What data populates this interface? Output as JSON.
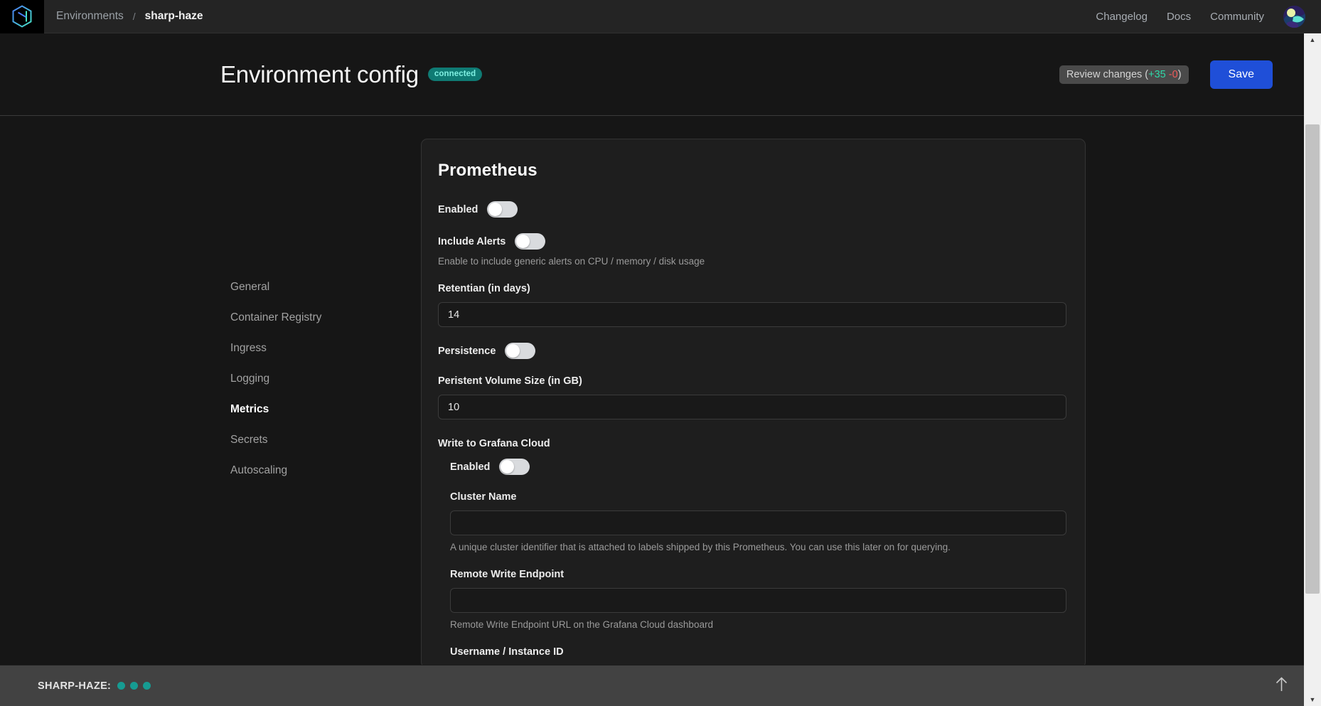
{
  "topnav": {
    "logo_icon": "hexagon-logo-icon",
    "breadcrumb": {
      "root_label": "Environments",
      "separator": "/",
      "current_label": "sharp-haze"
    },
    "links": [
      {
        "label": "Changelog",
        "name": "changelog"
      },
      {
        "label": "Docs",
        "name": "docs"
      },
      {
        "label": "Community",
        "name": "community"
      }
    ],
    "avatar_name": "user-avatar"
  },
  "header": {
    "title": "Environment config",
    "status_badge": "connected",
    "review_changes": {
      "prefix": "Review changes (",
      "additions": "+35",
      "spacer": " ",
      "deletions": "-0",
      "suffix": ")"
    },
    "save_label": "Save"
  },
  "sidebar": {
    "items": [
      {
        "label": "General",
        "name": "general",
        "active": false
      },
      {
        "label": "Container Registry",
        "name": "container-registry",
        "active": false
      },
      {
        "label": "Ingress",
        "name": "ingress",
        "active": false
      },
      {
        "label": "Logging",
        "name": "logging",
        "active": false
      },
      {
        "label": "Metrics",
        "name": "metrics",
        "active": true
      },
      {
        "label": "Secrets",
        "name": "secrets",
        "active": false
      },
      {
        "label": "Autoscaling",
        "name": "autoscaling",
        "active": false
      }
    ]
  },
  "panel": {
    "title": "Prometheus",
    "enabled": {
      "label": "Enabled",
      "state": "off"
    },
    "include_alerts": {
      "label": "Include Alerts",
      "state": "off",
      "help": "Enable to include generic alerts on CPU / memory / disk usage"
    },
    "retention": {
      "label": "Retentian (in days)",
      "value": "14",
      "placeholder": ""
    },
    "persistence": {
      "label": "Persistence",
      "state": "off"
    },
    "volume_size": {
      "label": "Peristent Volume Size (in GB)",
      "value": "10",
      "placeholder": ""
    },
    "grafana": {
      "title": "Write to Grafana Cloud",
      "enabled": {
        "label": "Enabled",
        "state": "off"
      },
      "cluster_name": {
        "label": "Cluster Name",
        "value": "",
        "placeholder": "",
        "help": "A unique cluster identifier that is attached to labels shipped by this Prometheus. You can use this later on for querying."
      },
      "remote_write_endpoint": {
        "label": "Remote Write Endpoint",
        "value": "",
        "placeholder": "",
        "help": "Remote Write Endpoint URL on the Grafana Cloud dashboard"
      },
      "username": {
        "label": "Username / Instance ID",
        "value": "",
        "placeholder": ""
      }
    }
  },
  "bottom_bar": {
    "env_label": "SHARP-HAZE:",
    "dot_count": 3,
    "dot_color": "#169b92",
    "scroll_top_icon": "arrow-up-icon"
  },
  "scrollbar": {
    "up_icon": "scroll-up-arrow-icon",
    "down_icon": "scroll-down-arrow-icon"
  },
  "colors": {
    "accent_blue": "#1f4fd8",
    "badge_teal": "#0f7b74",
    "additions_green": "#2fd9a8",
    "deletions_red": "#f05a5a"
  }
}
